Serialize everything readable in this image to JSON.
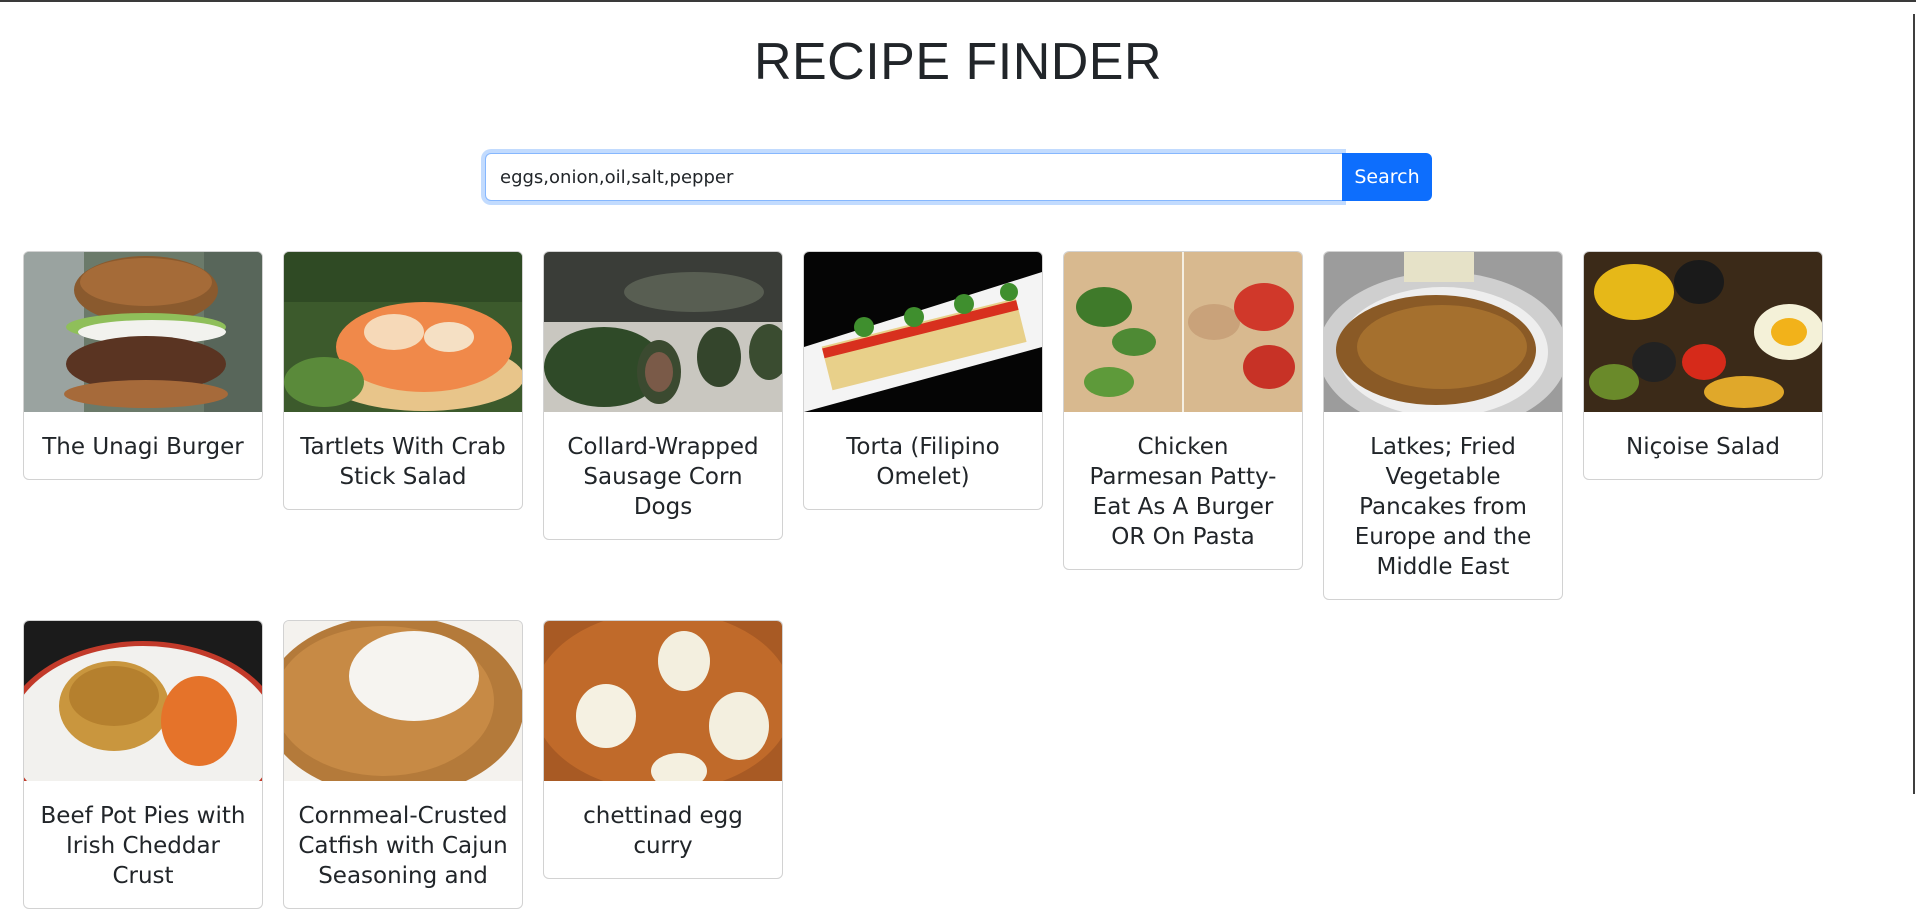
{
  "page": {
    "title": "RECIPE FINDER"
  },
  "search": {
    "value": "eggs,onion,oil,salt,pepper",
    "button_label": "Search",
    "accent": "#0d6efd"
  },
  "recipes": [
    {
      "title": "The Unagi Burger",
      "image": "burger-photo"
    },
    {
      "title": "Tartlets With Crab Stick Salad",
      "image": "tartlet-photo"
    },
    {
      "title": "Collard-Wrapped Sausage Corn Dogs",
      "image": "collard-rolls-photo"
    },
    {
      "title": "Torta (Filipino Omelet)",
      "image": "omelet-rolls-photo"
    },
    {
      "title": "Chicken Parmesan Patty- Eat As A Burger OR On Pasta",
      "image": "herbs-tomato-photo"
    },
    {
      "title": "Latkes; Fried Vegetable Pancakes from Europe and the Middle East",
      "image": "latkes-photo"
    },
    {
      "title": "Niçoise Salad",
      "image": "salad-photo"
    },
    {
      "title": "Beef Pot Pies with Irish Cheddar Crust",
      "image": "pot-pie-photo"
    },
    {
      "title": "Cornmeal-Crusted Catfish with Cajun Seasoning and",
      "image": "catfish-photo"
    },
    {
      "title": "chettinad egg curry",
      "image": "egg-curry-photo"
    }
  ]
}
